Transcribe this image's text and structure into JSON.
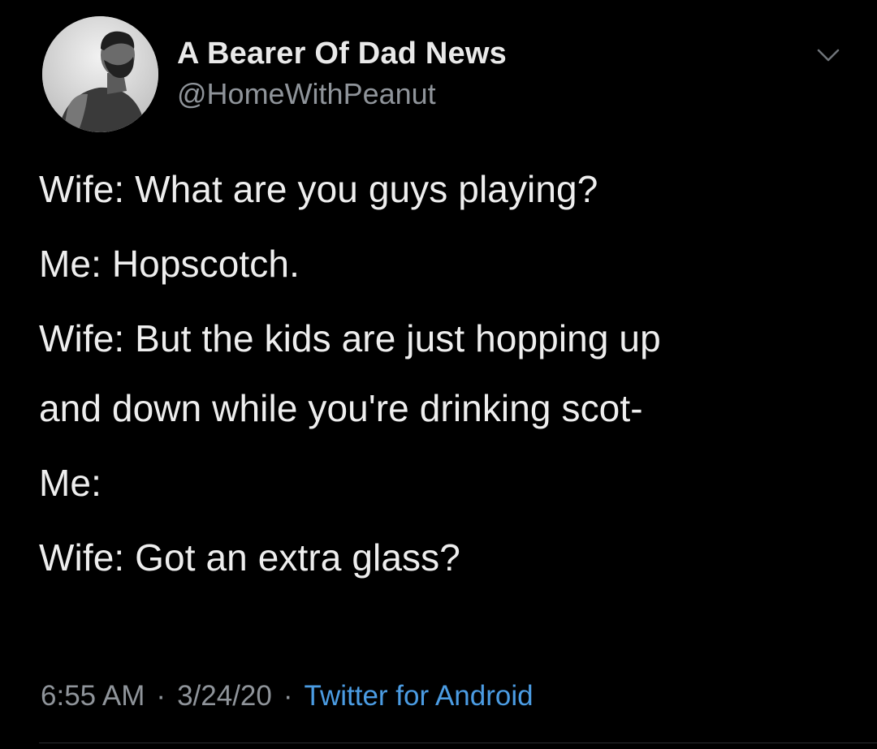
{
  "tweet": {
    "author": {
      "display_name": "A Bearer Of Dad News",
      "handle": "@HomeWithPeanut",
      "avatar_icon": "profile-photo"
    },
    "menu_icon": "chevron-down-icon",
    "lines": [
      "Wife: What are you guys playing?",
      "Me: Hopscotch.",
      "Wife: But the kids are just hopping up",
      "and down while you're drinking scot-",
      "Me:",
      "Wife: Got an extra glass?"
    ],
    "meta": {
      "time": "6:55 AM",
      "separator": "·",
      "date": "3/24/20",
      "source": "Twitter for Android"
    }
  },
  "colors": {
    "background": "#000000",
    "text": "#eeeeee",
    "secondary": "#8f949a",
    "link": "#4b9ce3"
  }
}
